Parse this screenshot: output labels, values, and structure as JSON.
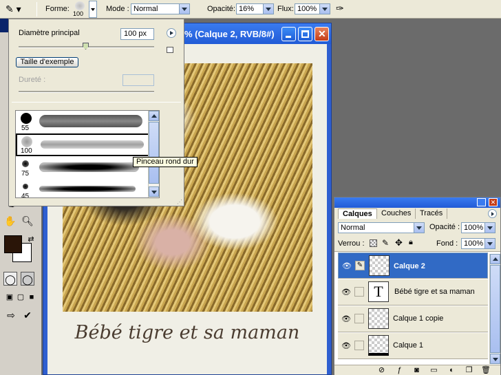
{
  "options_bar": {
    "forme_label": "Forme:",
    "brush_size": "100",
    "mode_label": "Mode :",
    "mode_value": "Normal",
    "opacity_label": "Opacité:",
    "opacity_value": "16%",
    "flux_label": "Flux:",
    "flux_value": "100%"
  },
  "document": {
    "title": "% (Calque 2, RVB/8#)",
    "caption": "Bébé tigre et sa maman"
  },
  "brush_popup": {
    "diameter_label": "Diamètre principal",
    "diameter_value": "100 px",
    "sample_size_button": "Taille d'exemple",
    "hardness_label": "Dureté :",
    "hardness_value": "",
    "presets": [
      {
        "size": "55"
      },
      {
        "size": "100"
      },
      {
        "size": "75"
      },
      {
        "size": "45"
      }
    ],
    "tooltip": "Pinceau rond dur"
  },
  "layers_panel": {
    "tabs": [
      "Calques",
      "Couches",
      "Tracés"
    ],
    "blend_mode": "Normal",
    "opacity_label": "Opacité :",
    "opacity_value": "100%",
    "lock_label": "Verrou :",
    "fill_label": "Fond :",
    "fill_value": "100%",
    "layers": [
      {
        "name": "Calque 2",
        "selected": true
      },
      {
        "name": "Bébé tigre et sa maman",
        "type": "text",
        "thumb_letter": "T"
      },
      {
        "name": "Calque 1 copie"
      },
      {
        "name": "Calque 1"
      }
    ]
  },
  "colors": {
    "accent": "#316ac5",
    "title_bar": "#215bd6",
    "foreground_swatch": "#2a1508",
    "background_swatch": "#ffffff"
  }
}
